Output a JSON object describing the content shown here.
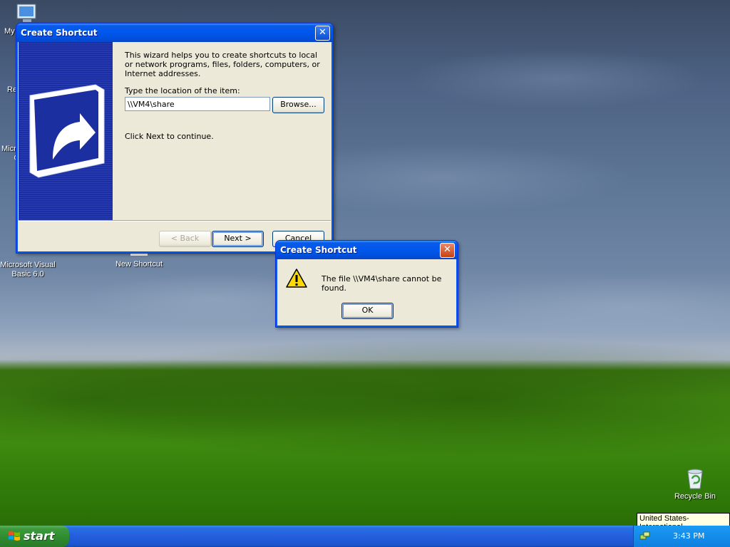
{
  "desktop_icons": [
    {
      "label": "My",
      "icon": "my-computer-icon"
    },
    {
      "label": "Re",
      "icon": "recycle-icon-partial"
    },
    {
      "label": "Micro",
      "icon": "ms-icon-partial",
      "label2": "C"
    },
    {
      "label": "Microsoft Visual",
      "label2": "Basic 6.0",
      "icon": "visual-basic-icon"
    },
    {
      "label": "New Shortcut",
      "icon": "shortcut-icon"
    },
    {
      "label": "Recycle Bin",
      "icon": "recycle-bin-icon"
    }
  ],
  "wizard": {
    "title": "Create Shortcut",
    "intro": "This wizard helps you to create shortcuts to local or network programs, files, folders, computers, or Internet addresses.",
    "location_label": "Type the location of the item:",
    "location_value": "\\\\VM4\\share",
    "browse_label": "Browse...",
    "continue_text": "Click Next to continue.",
    "back_label": "< Back",
    "next_label": "Next >",
    "cancel_label": "Cancel"
  },
  "error_dialog": {
    "title": "Create Shortcut",
    "message": "The file \\\\VM4\\share cannot be found.",
    "ok_label": "OK",
    "icon": "warning-icon"
  },
  "taskbar": {
    "start_label": "start",
    "clock": "3:43 PM",
    "tooltip": "United States-International"
  }
}
